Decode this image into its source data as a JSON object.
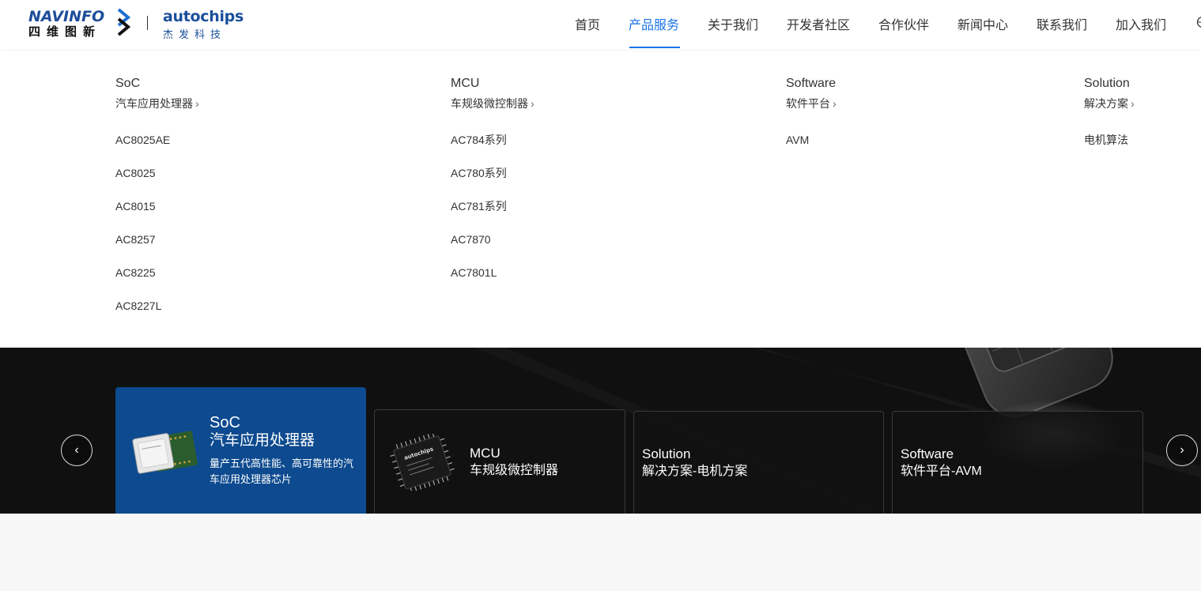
{
  "logo": {
    "navinfo_en": "NAVINFO",
    "navinfo_cn": "四维图新",
    "autochips_en": "autochips",
    "autochips_cn": "杰发科技"
  },
  "nav": {
    "items": [
      "首页",
      "产品服务",
      "关于我们",
      "开发者社区",
      "合作伙伴",
      "新闻中心",
      "联系我们",
      "加入我们"
    ],
    "active": "产品服务"
  },
  "menu": {
    "columns": [
      {
        "title": "SoC",
        "subtitle": "汽车应用处理器",
        "items": [
          "AC8025AE",
          "AC8025",
          "AC8015",
          "AC8257",
          "AC8225",
          "AC8227L"
        ]
      },
      {
        "title": "MCU",
        "subtitle": "车规级微控制器",
        "items": [
          "AC784系列",
          "AC780系列",
          "AC781系列",
          "AC7870",
          "AC7801L"
        ]
      },
      {
        "title": "Software",
        "subtitle": "软件平台",
        "items": [
          "AVM"
        ]
      },
      {
        "title": "Solution",
        "subtitle": "解决方案",
        "items": [
          "电机算法"
        ]
      }
    ]
  },
  "banner": {
    "prev_label": "‹",
    "next_label": "›",
    "cards": [
      {
        "title": "SoC",
        "subtitle": "汽车应用处理器",
        "desc": "量产五代高性能、高可靠性的汽车应用处理器芯片"
      },
      {
        "title": "MCU",
        "subtitle": "车规级微控制器",
        "chip_brand": "autochips"
      },
      {
        "title": "Solution",
        "subtitle": "解决方案-电机方案"
      },
      {
        "title": "Software",
        "subtitle": "软件平台-AVM"
      }
    ]
  },
  "colors": {
    "accent": "#1a73e8",
    "brand_blue": "#1a4f9c",
    "active_card": "#0d4a8f"
  }
}
